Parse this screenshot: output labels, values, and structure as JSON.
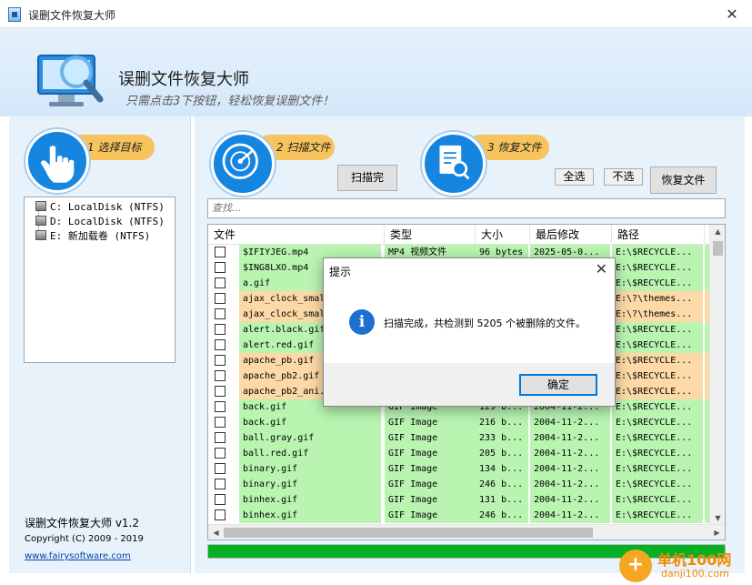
{
  "window": {
    "title": "误删文件恢复大师",
    "close_glyph": "✕"
  },
  "banner": {
    "app_name": "误删文件恢复大师",
    "slogan": "只需点击3下按钮，轻松恢复误删文件！"
  },
  "steps": [
    {
      "label": "1 选择目标"
    },
    {
      "label": "2 扫描文件"
    },
    {
      "label": "3 恢复文件"
    }
  ],
  "drives": [
    {
      "label": "C: LocalDisk (NTFS)"
    },
    {
      "label": "D: LocalDisk (NTFS)"
    },
    {
      "label": "E: 新加载卷 (NTFS)"
    }
  ],
  "buttons": {
    "scan_done": "扫描完",
    "select_all": "全选",
    "select_none": "不选",
    "recover": "恢复文件"
  },
  "search": {
    "placeholder": "查找..."
  },
  "table": {
    "headers": [
      "文件",
      "类型",
      "大小",
      "最后修改",
      "路径"
    ],
    "rows": [
      {
        "name": "$IFIYJEG.mp4",
        "type": "MP4 视频文件",
        "size": "96 bytes",
        "date": "2025-05-0...",
        "path": "E:\\$RECYCLE...",
        "ext": "1",
        "color": "green"
      },
      {
        "name": "$ING8LXO.mp4",
        "type": "",
        "size": "",
        "date": "",
        "path": "E:\\$RECYCLE...",
        "ext": "",
        "color": "green"
      },
      {
        "name": "a.gif",
        "type": "",
        "size": "",
        "date": "",
        "path": "E:\\$RECYCLE...",
        "ext": "",
        "color": "green"
      },
      {
        "name": "ajax_clock_smal",
        "type": "",
        "size": "",
        "date": "",
        "path": "E:\\?\\themes...",
        "ext": "",
        "color": "orange"
      },
      {
        "name": "ajax_clock_smal",
        "type": "",
        "size": "",
        "date": "",
        "path": "E:\\?\\themes...",
        "ext": "",
        "color": "orange"
      },
      {
        "name": "alert.black.gif",
        "type": "",
        "size": "",
        "date": "",
        "path": "E:\\$RECYCLE...",
        "ext": "",
        "color": "green"
      },
      {
        "name": "alert.red.gif",
        "type": "",
        "size": "",
        "date": "",
        "path": "E:\\$RECYCLE...",
        "ext": "",
        "color": "green"
      },
      {
        "name": "apache_pb.gif",
        "type": "",
        "size": "",
        "date": "",
        "path": "E:\\$RECYCLE...",
        "ext": "",
        "color": "orange"
      },
      {
        "name": "apache_pb2.gif",
        "type": "",
        "size": "",
        "date": "",
        "path": "E:\\$RECYCLE...",
        "ext": "",
        "color": "orange"
      },
      {
        "name": "apache_pb2_ani.",
        "type": "",
        "size": "",
        "date": "",
        "path": "E:\\$RECYCLE...",
        "ext": "",
        "color": "orange"
      },
      {
        "name": "back.gif",
        "type": "GIF Image",
        "size": "129 b...",
        "date": "2004-11-2...",
        "path": "E:\\$RECYCLE...",
        "ext": "",
        "color": "green"
      },
      {
        "name": "back.gif",
        "type": "GIF Image",
        "size": "216 b...",
        "date": "2004-11-2...",
        "path": "E:\\$RECYCLE...",
        "ext": "",
        "color": "green"
      },
      {
        "name": "ball.gray.gif",
        "type": "GIF Image",
        "size": "233 b...",
        "date": "2004-11-2...",
        "path": "E:\\$RECYCLE...",
        "ext": "",
        "color": "green"
      },
      {
        "name": "ball.red.gif",
        "type": "GIF Image",
        "size": "205 b...",
        "date": "2004-11-2...",
        "path": "E:\\$RECYCLE...",
        "ext": "",
        "color": "green"
      },
      {
        "name": "binary.gif",
        "type": "GIF Image",
        "size": "134 b...",
        "date": "2004-11-2...",
        "path": "E:\\$RECYCLE...",
        "ext": "",
        "color": "green"
      },
      {
        "name": "binary.gif",
        "type": "GIF Image",
        "size": "246 b...",
        "date": "2004-11-2...",
        "path": "E:\\$RECYCLE...",
        "ext": "",
        "color": "green"
      },
      {
        "name": "binhex.gif",
        "type": "GIF Image",
        "size": "131 b...",
        "date": "2004-11-2...",
        "path": "E:\\$RECYCLE...",
        "ext": "",
        "color": "green"
      },
      {
        "name": "binhex.gif",
        "type": "GIF Image",
        "size": "246 b...",
        "date": "2004-11-2...",
        "path": "E:\\$RECYCLE...",
        "ext": "",
        "color": "green"
      }
    ]
  },
  "progress": {
    "fraction": 1.0,
    "color": "#06b025"
  },
  "footer": {
    "version": "误删文件恢复大师 v1.2",
    "copyright": "Copyright (C) 2009 - 2019",
    "website": "www.fairysoftware.com"
  },
  "dialog": {
    "title": "提示",
    "close_glyph": "✕",
    "icon_glyph": "i",
    "message": "扫描完成，共检测到 5205 个被删除的文件。",
    "ok_label": "确定"
  },
  "watermark": {
    "text": "单机100网",
    "url": "danji100.com",
    "glyph": "+"
  },
  "colors": {
    "row_green": "#b9f5b1",
    "row_orange": "#fcd9a6",
    "step_blue": "#1685e0",
    "step_pill": "#f7c35c"
  }
}
